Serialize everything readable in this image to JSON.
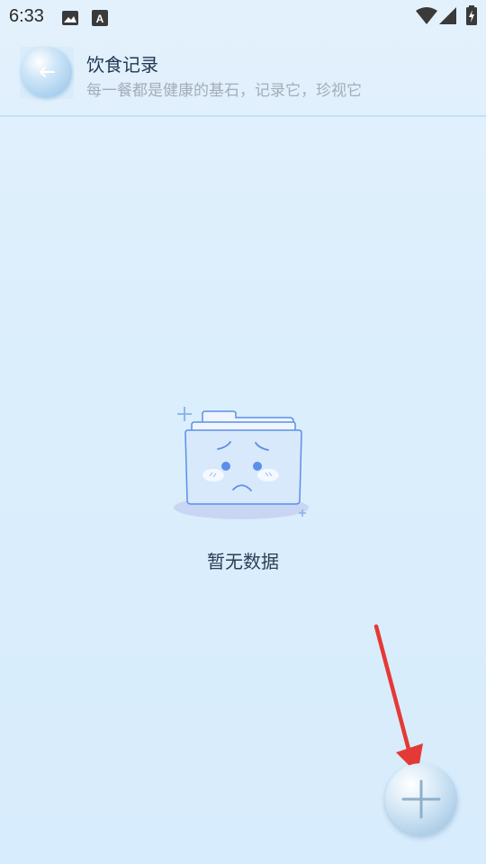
{
  "status_bar": {
    "time": "6:33",
    "icons": [
      "image-icon",
      "font-icon",
      "wifi-icon",
      "signal-icon",
      "battery-icon"
    ]
  },
  "header": {
    "title": "饮食记录",
    "subtitle": "每一餐都是健康的基石，记录它，珍视它",
    "back_icon": "arrow-left-icon"
  },
  "empty_state": {
    "message": "暂无数据",
    "illustration": "sad-folder-icon"
  },
  "fab": {
    "icon": "plus-icon"
  },
  "colors": {
    "accent": "#5b8fe8",
    "annotation_arrow": "#e53935",
    "title": "#1f3653",
    "subtitle": "#a3adb9"
  }
}
